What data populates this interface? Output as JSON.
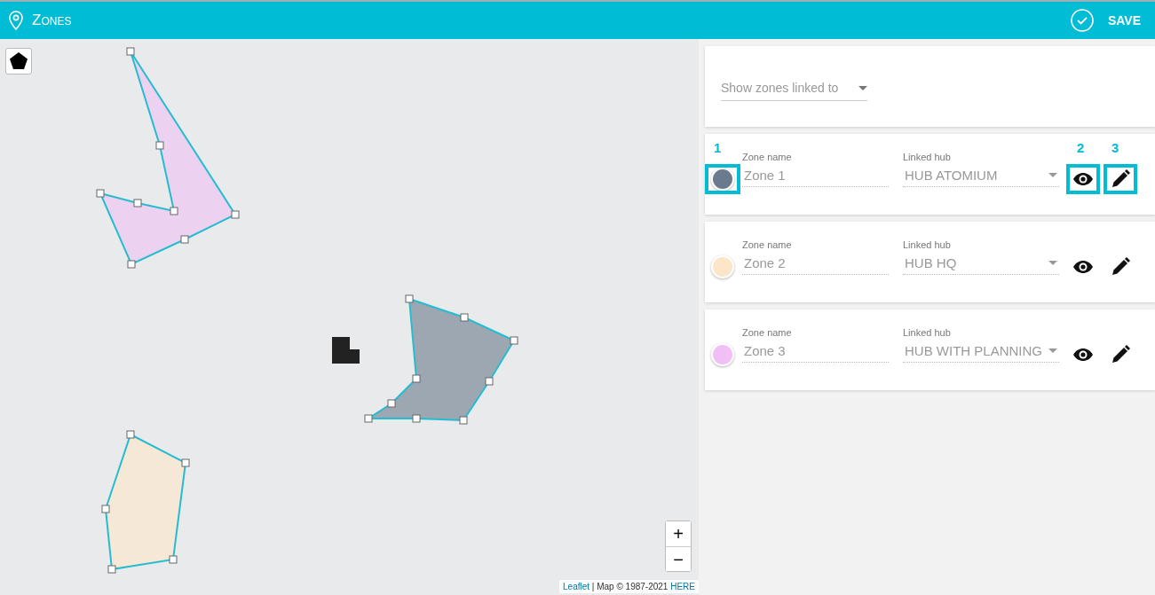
{
  "header": {
    "title": "Zones",
    "save_label": "SAVE"
  },
  "map": {
    "zoom_in": "+",
    "zoom_out": "−",
    "attribution": [
      {
        "text": "Leaflet",
        "kind": "link"
      },
      {
        "text": " | Map © 1987-2021 ",
        "kind": "text"
      },
      {
        "text": "HERE",
        "kind": "link"
      }
    ]
  },
  "filter": {
    "placeholder": "Show zones linked to"
  },
  "zones": [
    {
      "name_label": "Zone name",
      "name": "Zone 1",
      "hub_label": "Linked hub",
      "hub": "HUB ATOMIUM",
      "color": "#6b7a8c",
      "callouts": {
        "dot": "1",
        "view": "2",
        "edit": "3"
      }
    },
    {
      "name_label": "Zone name",
      "name": "Zone 2",
      "hub_label": "Linked hub",
      "hub": "HUB HQ",
      "color": "#fde6c8"
    },
    {
      "name_label": "Zone name",
      "name": "Zone 3",
      "hub_label": "Linked hub",
      "hub": "HUB WITH PLANNING",
      "color": "#f0bff5"
    }
  ]
}
